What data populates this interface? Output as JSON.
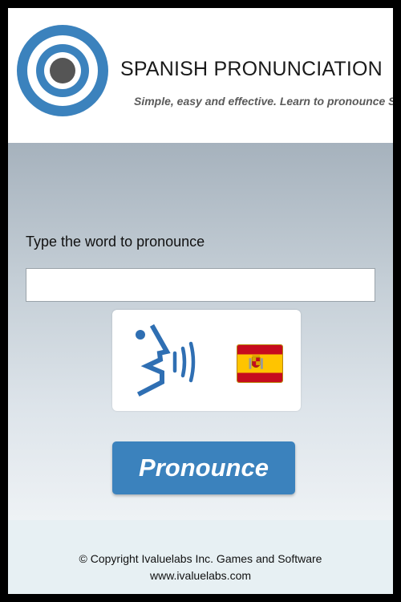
{
  "header": {
    "title": "SPANISH PRONUNCIATION",
    "tagline": "Simple, easy and effective. Learn to pronounce Spanish"
  },
  "main": {
    "prompt_label": "Type the word to pronounce",
    "word_input": {
      "value": "",
      "placeholder": ""
    },
    "voice_panel": {
      "icon": "speaking-head-icon",
      "flag": "spain-flag-icon"
    },
    "pronounce_label": "Pronounce"
  },
  "footer": {
    "copyright": "© Copyright Ivaluelabs Inc. Games and Software",
    "website": "www.ivaluelabs.com"
  },
  "colors": {
    "accent": "#3b82bd",
    "logo_blue": "#3b82bd",
    "logo_center": "#555555",
    "footer_bg": "#e7f0f3",
    "flag_red": "#c60b1e",
    "flag_yellow": "#ffc400"
  }
}
